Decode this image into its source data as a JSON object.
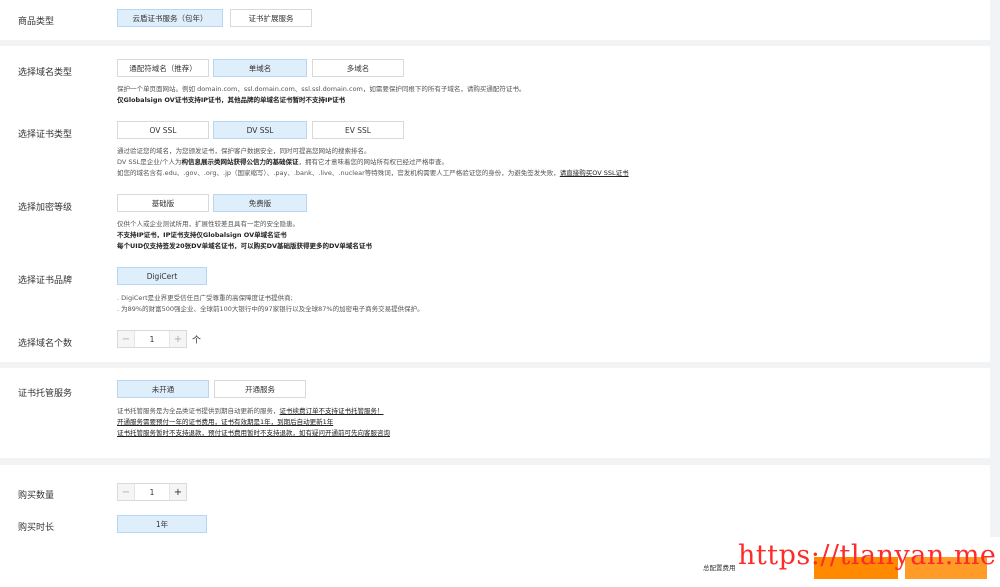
{
  "product_type": {
    "label": "商品类型",
    "options": [
      "云盾证书服务（包年）",
      "证书扩展服务"
    ],
    "selected": 0
  },
  "domain_type": {
    "label": "选择域名类型",
    "options": [
      "通配符域名（推荐）",
      "单域名",
      "多域名"
    ],
    "selected": 1,
    "desc_line1": "保护一个单页面网站。例如 domain.com、ssl.domain.com、ssl.ssl.domain.com，如需要保护同根下的所有子域名，请购买通配符证书。",
    "desc_line2": "仅Globalsign OV证书支持IP证书，其他品牌的单域名证书暂时不支持IP证书"
  },
  "cert_type": {
    "label": "选择证书类型",
    "options": [
      "OV SSL",
      "DV SSL",
      "EV SSL"
    ],
    "selected": 1,
    "desc_line1": "通过验证您的域名，为您颁发证书，保护客户数据安全，同时可提高您网站的搜索排名。",
    "desc_line2_a": "DV SSL是企业/个人为",
    "desc_line2_b": "构信息展示类网站获得公信力的基础保证",
    "desc_line2_c": "，拥有它才意味着您的网站所有权已经过严格审查。",
    "desc_line3_a": "如您的域名含有.edu、.gov、.org、.jp（国家缩写）、.pay、.bank、.live、.nuclear等特殊词，官发机构需要人工严格验证您的身份，为避免签发失败，",
    "desc_line3_link": "请直接购买OV SSL证书"
  },
  "encryption": {
    "label": "选择加密等级",
    "options": [
      "基础版",
      "免费版"
    ],
    "selected": 1,
    "desc_line1": "仅供个人或企业测试所用，扩展性较差且具有一定的安全隐患。",
    "desc_line2": "不支持IP证书，IP证书支持仅Globalsign OV单域名证书",
    "desc_line3": "每个UID仅支持签发20张DV单域名证书，可以购买DV基础版获得更多的DV单域名证书"
  },
  "brand": {
    "label": "选择证书品牌",
    "options": [
      "DigiCert"
    ],
    "selected": 0,
    "desc_line1": ". DigiCert是业界更受信任且广受尊重的高保障度证书提供商;",
    "desc_line2": ". 为89%的财富500强企业、全球前100大银行中的97家银行以及全球87%的加密电子商务交易提供保护。"
  },
  "domain_count": {
    "label": "选择域名个数",
    "value": "1",
    "minus": "−",
    "plus": "+",
    "unit": "个"
  },
  "hosting": {
    "label": "证书托管服务",
    "options": [
      "未开通",
      "开通服务"
    ],
    "selected": 0,
    "desc_line1_a": "证书托管服务是为全品类证书提供到期自动更新的服务，",
    "desc_line1_link": "证书续费订单不支持证书托管服务！",
    "desc_line2": "开通服务需要预付一年的证书费用，证书有效期是1年，到期后自动更新1年",
    "desc_line3": "证书托管服务暂时不支持退款，预付证书费用暂时不支持退款，如有疑问开通前可先向客服咨询"
  },
  "purchase_qty": {
    "label": "购买数量",
    "value": "1",
    "minus": "−",
    "plus": "+"
  },
  "duration": {
    "label": "购买时长",
    "options": [
      "1年"
    ],
    "selected": 0
  },
  "footer": {
    "total_label": "总配置费用"
  },
  "watermark": "https://tlanyan.me",
  "colors": {
    "selected_bg": "#dfeefb",
    "accent_orange": "#ff8a00",
    "watermark_red": "#ff2a2a"
  }
}
